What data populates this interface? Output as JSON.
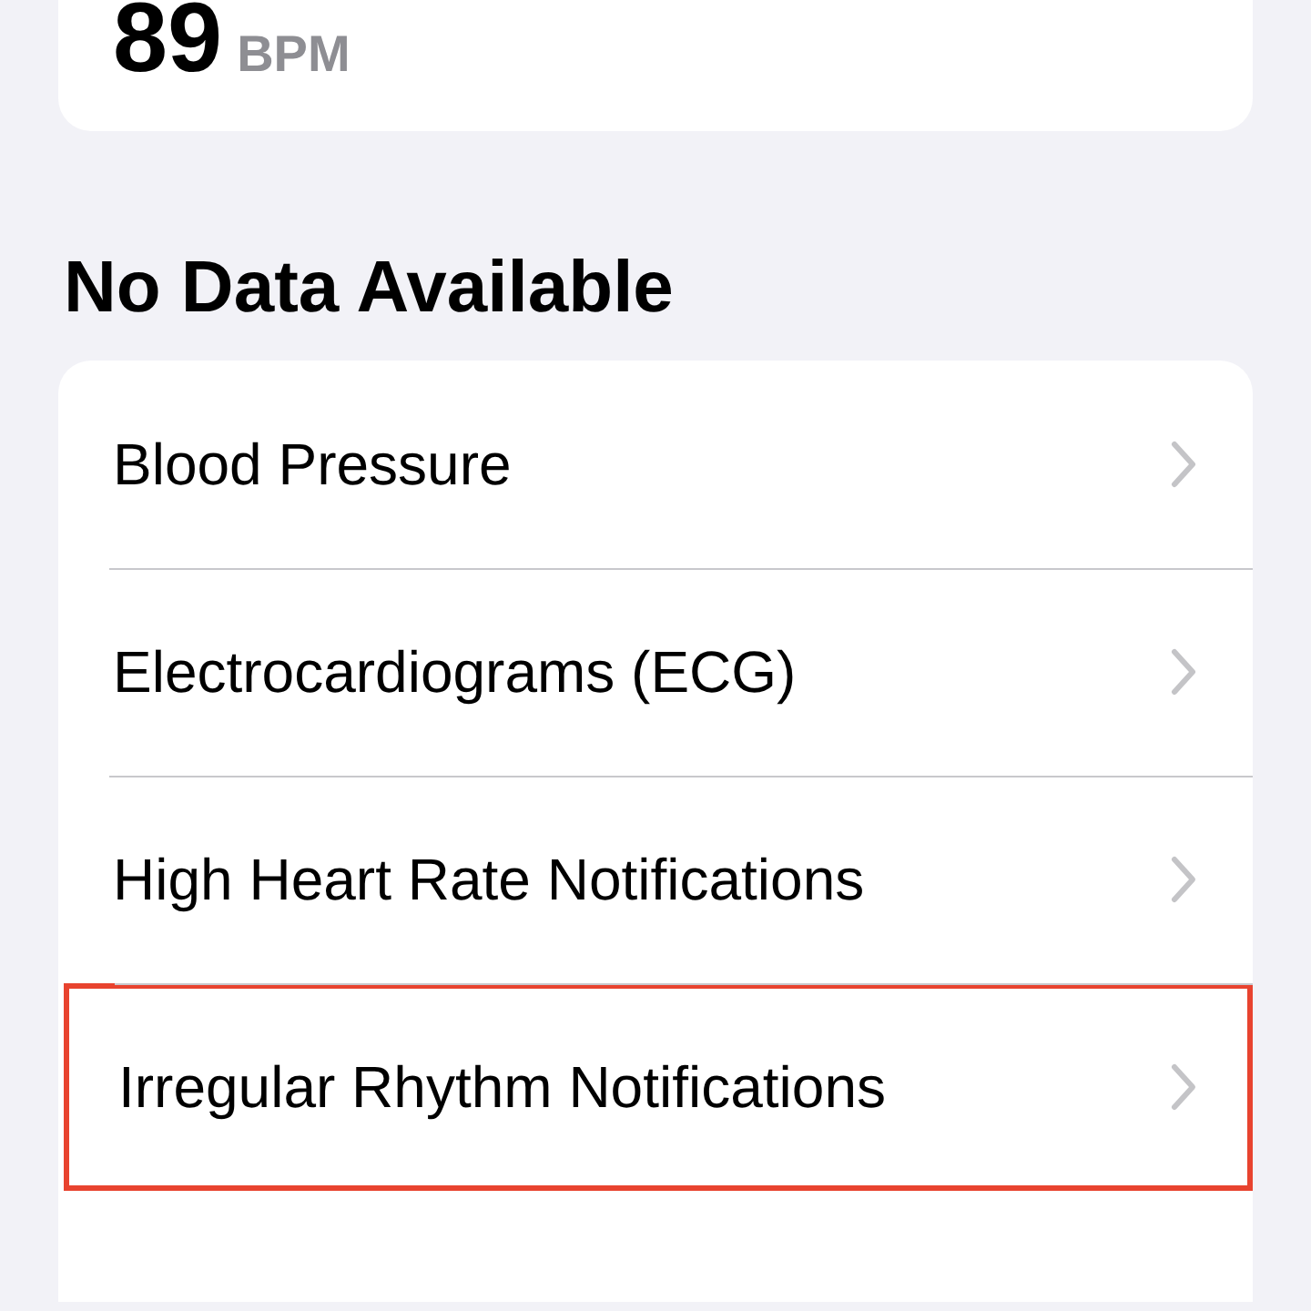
{
  "heart_rate": {
    "value": "89",
    "unit": "BPM"
  },
  "section": {
    "title": "No Data Available"
  },
  "items": [
    {
      "label": "Blood Pressure",
      "highlighted": false
    },
    {
      "label": "Electrocardiograms (ECG)",
      "highlighted": false
    },
    {
      "label": "High Heart Rate Notifications",
      "highlighted": false
    },
    {
      "label": "Irregular Rhythm Notifications",
      "highlighted": true
    }
  ]
}
